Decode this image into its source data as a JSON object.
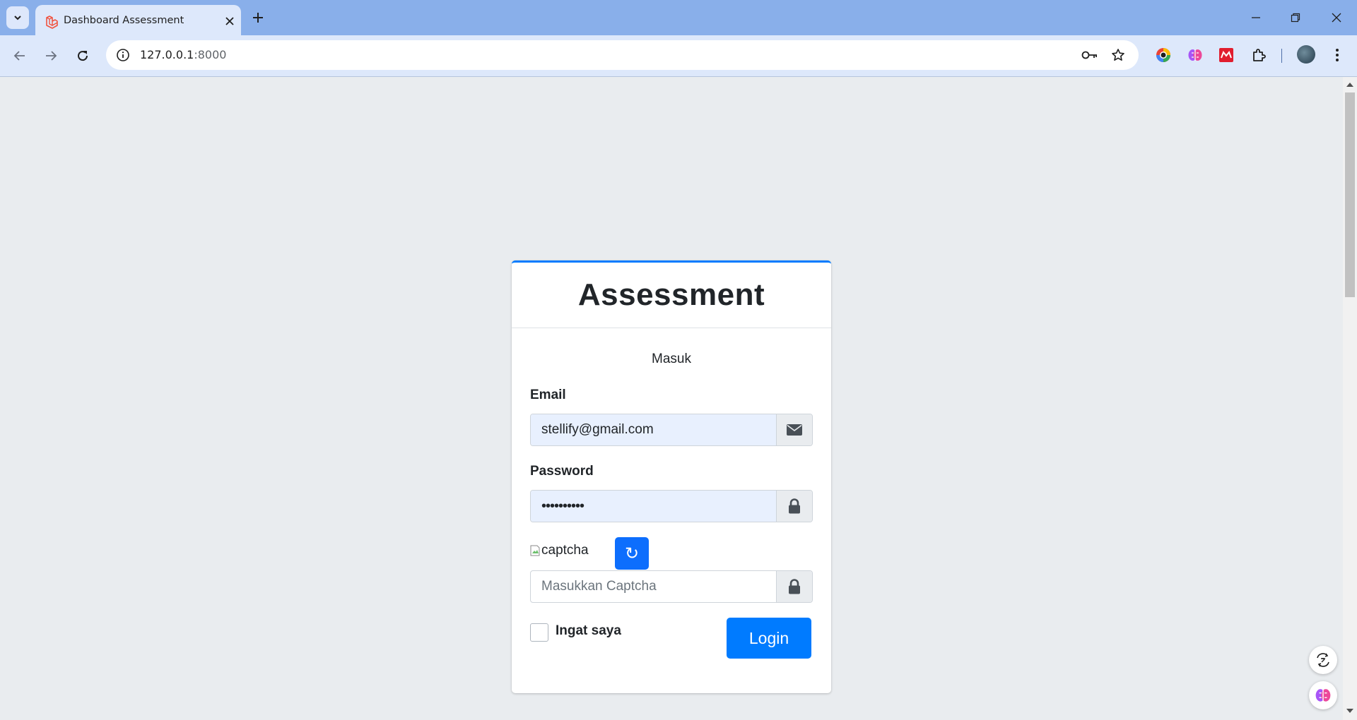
{
  "browser": {
    "tab": {
      "title": "Dashboard Assessment"
    },
    "url": {
      "host": "127.0.0.1",
      "port": ":8000"
    }
  },
  "login": {
    "brand": "Assessment",
    "subtitle": "Masuk",
    "email": {
      "label": "Email",
      "value": "stellify@gmail.com"
    },
    "password": {
      "label": "Password",
      "value": "••••••••••"
    },
    "captcha": {
      "image_alt": "captcha",
      "refresh_symbol": "↻",
      "placeholder": "Masukkan Captcha"
    },
    "remember_label": "Ingat saya",
    "submit_label": "Login"
  },
  "colors": {
    "primary": "#007bff",
    "page_background": "#e9ecef",
    "chrome_tabstrip": "#89afea",
    "chrome_toolbar": "#dde8fb"
  }
}
